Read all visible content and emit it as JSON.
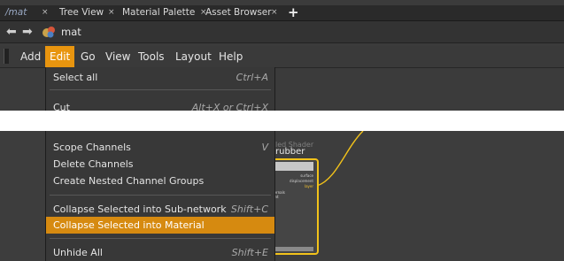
{
  "tabs": [
    {
      "label": "/mat",
      "active": true
    },
    {
      "label": "Tree View",
      "active": false
    },
    {
      "label": "Material Palette",
      "active": false
    },
    {
      "label": "Asset Browser",
      "active": false
    }
  ],
  "tab_close_glyph": "×",
  "tab_add_glyph": "+",
  "path": {
    "label": "mat",
    "back_icon": "back-arrow-icon",
    "forward_icon": "forward-arrow-icon",
    "context_icon": "material-context-icon"
  },
  "menubar": {
    "items": [
      "Add",
      "Edit",
      "Go",
      "View",
      "Tools",
      "Layout",
      "Help"
    ],
    "open_item": "Edit"
  },
  "edit_menu_top": [
    {
      "label": "Select all",
      "shortcut": "Ctrl+A"
    },
    {
      "label": "Cut",
      "shortcut": "Alt+X or Ctrl+X"
    }
  ],
  "edit_menu_bottom": [
    {
      "label": "Scope Channels",
      "shortcut": "V"
    },
    {
      "label": "Delete Channels",
      "shortcut": ""
    },
    {
      "label": "Create Nested Channel Groups",
      "shortcut": ""
    },
    {
      "label": "Collapse Selected into Sub-network",
      "shortcut": "Shift+C"
    },
    {
      "label": "Collapse Selected into Material",
      "shortcut": "",
      "highlighted": true
    },
    {
      "label": "Unhide All",
      "shortcut": "Shift+E"
    }
  ],
  "node": {
    "type_label": "led Shader",
    "name": "rubber",
    "outputs": [
      "surface",
      "displacement",
      "layer"
    ],
    "inputs_left": [
      "ternals",
      "ont"
    ]
  },
  "colors": {
    "accent": "#e8950f",
    "highlight": "#d68a10",
    "node_border": "#f2c21a",
    "wire": "#f2c21a"
  }
}
